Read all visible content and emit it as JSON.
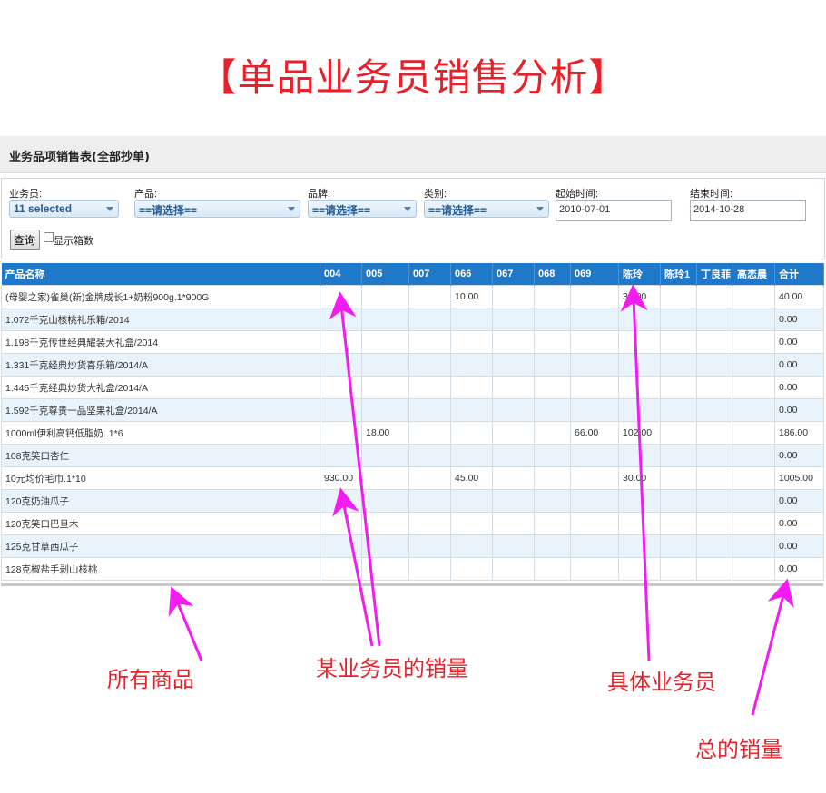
{
  "title": "【单品业务员销售分析】",
  "panel": {
    "heading": "业务品项销售表(全部抄单)"
  },
  "filters": {
    "salesman_label": "业务员:",
    "salesman_value": "11 selected",
    "product_label": "产品:",
    "product_value": "==请选择==",
    "brand_label": "品牌:",
    "brand_value": "==请选择==",
    "category_label": "类别:",
    "category_value": "==请选择==",
    "start_label": "起始时间:",
    "start_value": "2010-07-01",
    "end_label": "结束时间:",
    "end_value": "2014-10-28",
    "query_label": "查询",
    "show_boxes_label": "显示箱数"
  },
  "table": {
    "columns": [
      "产品名称",
      "004",
      "005",
      "007",
      "066",
      "067",
      "068",
      "069",
      "陈玲",
      "陈玲1",
      "丁良菲",
      "高恋晨",
      "合计"
    ],
    "rows": [
      [
        "(母婴之家)雀巢(新)金牌成长1+奶粉900g.1*900G",
        "",
        "",
        "",
        "10.00",
        "",
        "",
        "",
        "30.00",
        "",
        "",
        "",
        "40.00"
      ],
      [
        "1.072千克山核桃礼乐箱/2014",
        "",
        "",
        "",
        "",
        "",
        "",
        "",
        "",
        "",
        "",
        "",
        "0.00"
      ],
      [
        "1.198千克传世经典耀装大礼盒/2014",
        "",
        "",
        "",
        "",
        "",
        "",
        "",
        "",
        "",
        "",
        "",
        "0.00"
      ],
      [
        "1.331千克经典炒货喜乐箱/2014/A",
        "",
        "",
        "",
        "",
        "",
        "",
        "",
        "",
        "",
        "",
        "",
        "0.00"
      ],
      [
        "1.445千克经典炒货大礼盒/2014/A",
        "",
        "",
        "",
        "",
        "",
        "",
        "",
        "",
        "",
        "",
        "",
        "0.00"
      ],
      [
        "1.592千克尊贵一品坚果礼盒/2014/A",
        "",
        "",
        "",
        "",
        "",
        "",
        "",
        "",
        "",
        "",
        "",
        "0.00"
      ],
      [
        "1000ml伊利高钙低脂奶..1*6",
        "",
        "18.00",
        "",
        "",
        "",
        "",
        "66.00",
        "102.00",
        "",
        "",
        "",
        "186.00"
      ],
      [
        "108克笑口杏仁",
        "",
        "",
        "",
        "",
        "",
        "",
        "",
        "",
        "",
        "",
        "",
        "0.00"
      ],
      [
        "10元均价毛巾.1*10",
        "930.00",
        "",
        "",
        "45.00",
        "",
        "",
        "",
        "30.00",
        "",
        "",
        "",
        "1005.00"
      ],
      [
        "120克奶油瓜子",
        "",
        "",
        "",
        "",
        "",
        "",
        "",
        "",
        "",
        "",
        "",
        "0.00"
      ],
      [
        "120克笑口巴旦木",
        "",
        "",
        "",
        "",
        "",
        "",
        "",
        "",
        "",
        "",
        "",
        "0.00"
      ],
      [
        "125克甘草西瓜子",
        "",
        "",
        "",
        "",
        "",
        "",
        "",
        "",
        "",
        "",
        "",
        "0.00"
      ],
      [
        "128克椒盐手剥山核桃",
        "",
        "",
        "",
        "",
        "",
        "",
        "",
        "",
        "",
        "",
        "",
        "0.00"
      ]
    ]
  },
  "annotations": {
    "all_products": "所有商品",
    "salesman_sales": "某业务员的销量",
    "specific_salesman": "具体业务员",
    "total_sales": "总的销量"
  },
  "colors": {
    "accent_red": "#e8202a",
    "arrow_magenta": "#f21cf0",
    "header_blue": "#1f78c8",
    "row_alt": "#e8f3fc"
  }
}
